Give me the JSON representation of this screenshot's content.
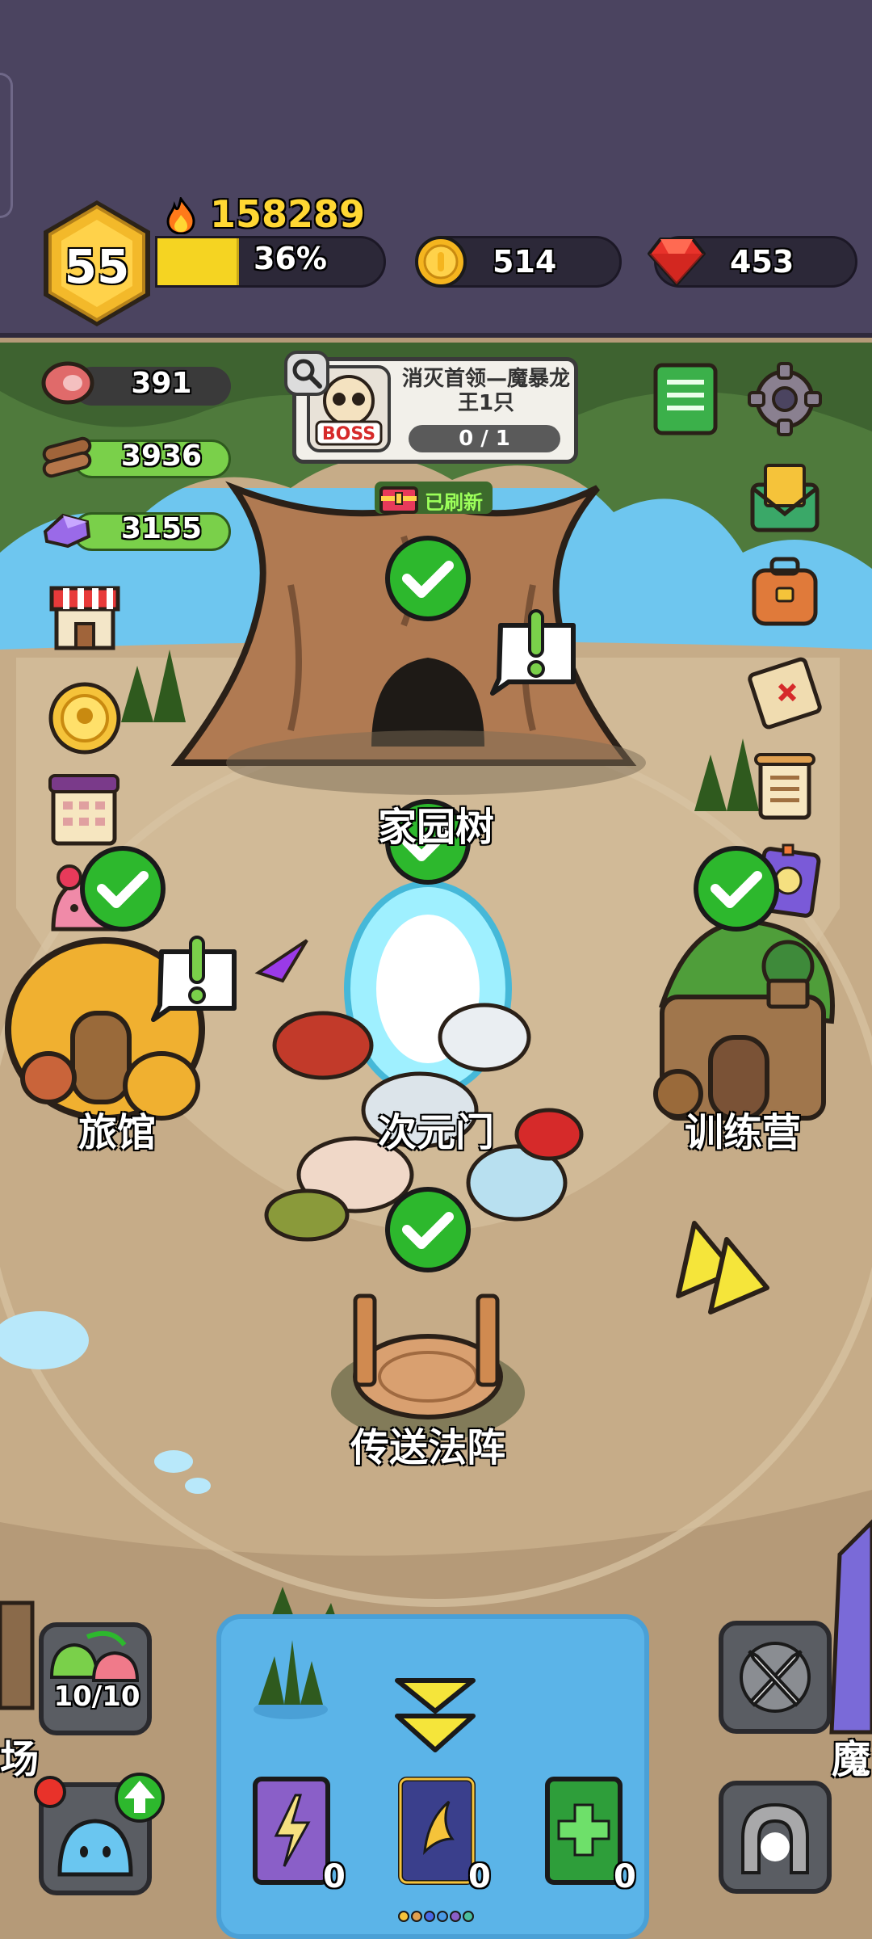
{
  "player": {
    "level": "55",
    "power": "158289",
    "xp_percent_label": "36%",
    "xp_fraction": 0.36
  },
  "currencies": {
    "coins": "514",
    "gems": "453"
  },
  "resources": [
    {
      "name": "meat-icon",
      "value": "391"
    },
    {
      "name": "wood-icon",
      "value": "3936"
    },
    {
      "name": "crystal-icon",
      "value": "3155"
    }
  ],
  "boss_quest": {
    "badge": "BOSS",
    "title": "消灭首领—魔暴龙王1只",
    "progress": "0 / 1",
    "refresh_label": "已刷新"
  },
  "buildings": {
    "tree_label": "家园树",
    "inn_label": "旅馆",
    "portal_label": "次元门",
    "training_label": "训练营",
    "teleport_label": "传送法阵"
  },
  "edge_labels": {
    "left": "场",
    "right": "魔"
  },
  "bottom": {
    "slime_count": "10/10",
    "books": [
      {
        "name": "lightning-book",
        "count": "0",
        "color": "#8a5fc8"
      },
      {
        "name": "wing-book",
        "count": "0",
        "color": "#3a3f8c"
      },
      {
        "name": "heal-book",
        "count": "0",
        "color": "#2e9e3a"
      }
    ]
  },
  "colors": {
    "topbar": "#4b4460",
    "xp_fill": "#f5d422",
    "ground": "#c6ac88",
    "water": "#6ec6ef",
    "check_green": "#2db82d"
  }
}
